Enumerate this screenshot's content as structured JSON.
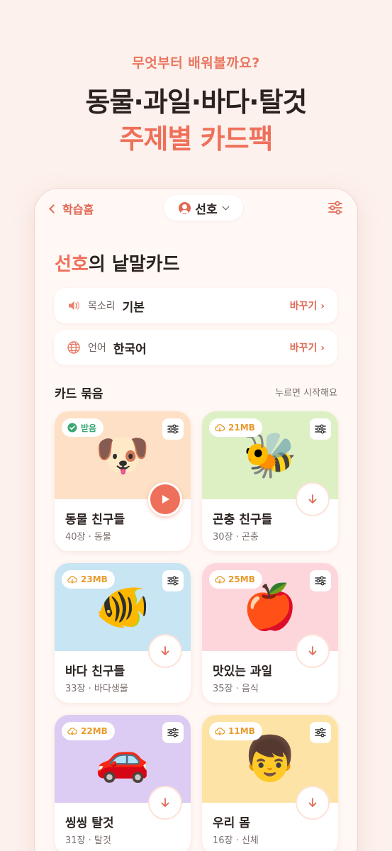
{
  "hero": {
    "subtitle": "무엇부터 배워볼까요?",
    "title_line1": "동물·과일·바다·탈것",
    "title_line2": "주제별 카드팩"
  },
  "topbar": {
    "back_label": "학습홈",
    "profile_name": "선호",
    "filter_icon": "sliders-icon"
  },
  "page": {
    "title_name": "선호",
    "title_suffix": "의 낱말카드"
  },
  "settings": [
    {
      "icon": "speaker-icon",
      "label": "목소리",
      "value": "기본",
      "change": "바꾸기 ›"
    },
    {
      "icon": "globe-icon",
      "label": "언어",
      "value": "한국어",
      "change": "바꾸기 ›"
    }
  ],
  "section": {
    "title": "카드 묶음",
    "hint": "누르면 시작해요"
  },
  "cards": [
    {
      "title": "동물 친구들",
      "meta": "40장 · 동물",
      "badge": "받음",
      "badge_type": "downloaded",
      "emoji": "🐶",
      "bg": "#fde0c5",
      "action": "play"
    },
    {
      "title": "곤충 친구들",
      "meta": "30장 · 곤충",
      "badge": "21MB",
      "badge_type": "size",
      "emoji": "🐝",
      "bg": "#ddf0c4",
      "action": "download"
    },
    {
      "title": "바다 친구들",
      "meta": "33장 · 바다생물",
      "badge": "23MB",
      "badge_type": "size",
      "emoji": "🐠",
      "bg": "#c7e5f3",
      "action": "download"
    },
    {
      "title": "맛있는 과일",
      "meta": "35장 · 음식",
      "badge": "25MB",
      "badge_type": "size",
      "emoji": "🍎",
      "bg": "#fdd6dc",
      "action": "download"
    },
    {
      "title": "씽씽 탈것",
      "meta": "31장 · 탈것",
      "badge": "22MB",
      "badge_type": "size",
      "emoji": "🚗",
      "bg": "#dccbf2",
      "action": "download"
    },
    {
      "title": "우리 몸",
      "meta": "16장 · 신체",
      "badge": "11MB",
      "badge_type": "size",
      "emoji": "👦",
      "bg": "#fde4a6",
      "action": "download"
    }
  ],
  "colors": {
    "accent": "#ef705a",
    "background": "#fdf1ed",
    "size_badge": "#e89a2c",
    "downloaded_badge": "#3aa774"
  }
}
